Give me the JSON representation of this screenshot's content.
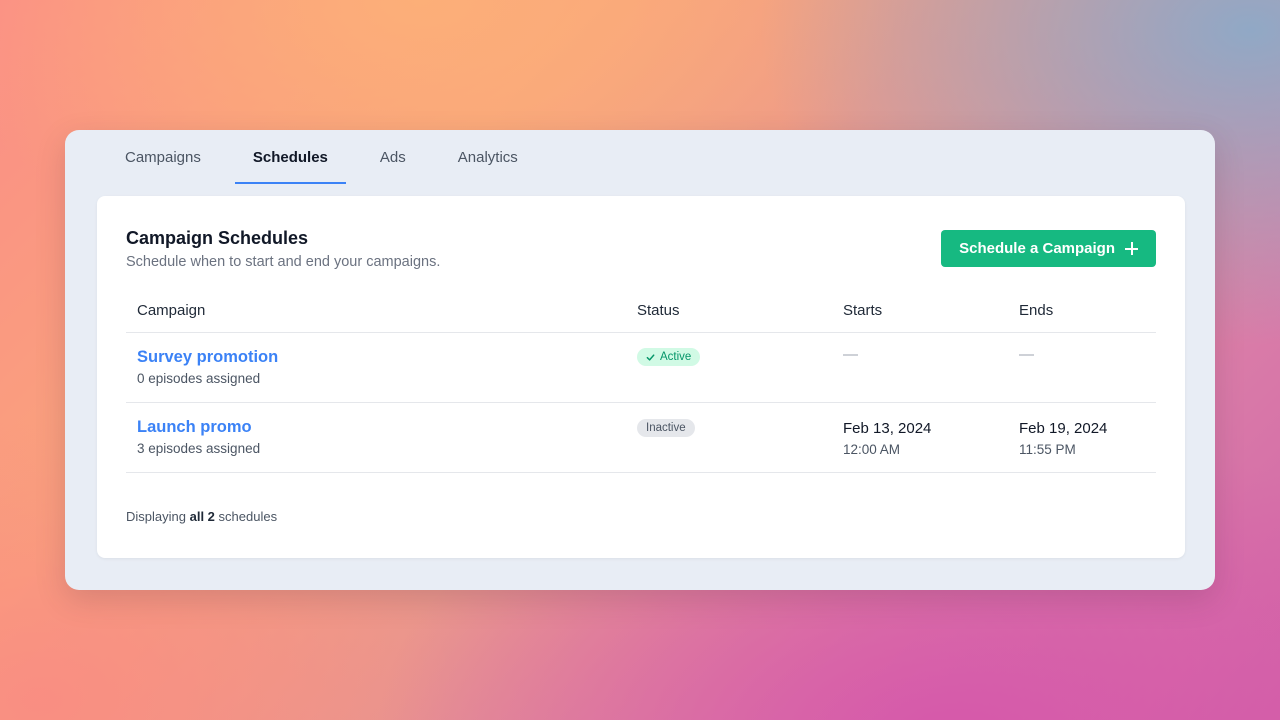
{
  "tabs": [
    {
      "label": "Campaigns",
      "active": false
    },
    {
      "label": "Schedules",
      "active": true
    },
    {
      "label": "Ads",
      "active": false
    },
    {
      "label": "Analytics",
      "active": false
    }
  ],
  "card": {
    "title": "Campaign Schedules",
    "subtitle": "Schedule when to start and end your campaigns.",
    "action_label": "Schedule a Campaign"
  },
  "table": {
    "columns": [
      "Campaign",
      "Status",
      "Starts",
      "Ends"
    ],
    "rows": [
      {
        "name": "Survey promotion",
        "episodes": "0 episodes assigned",
        "status": "Active",
        "starts_date": "—",
        "starts_time": "",
        "ends_date": "—",
        "ends_time": ""
      },
      {
        "name": "Launch promo",
        "episodes": "3 episodes assigned",
        "status": "Inactive",
        "starts_date": "Feb 13, 2024",
        "starts_time": "12:00 AM",
        "ends_date": "Feb 19, 2024",
        "ends_time": "11:55 PM"
      }
    ]
  },
  "footer": {
    "prefix": "Displaying",
    "count": "all 2",
    "suffix": "schedules"
  },
  "colors": {
    "accent": "#3b82f6",
    "primary_button": "#16b981",
    "active_badge_bg": "#d1fae5",
    "active_badge_text": "#059669",
    "inactive_badge_bg": "#e5e7eb"
  },
  "icons": {
    "button_icon": "plus-icon",
    "active_badge_icon": "check-icon"
  }
}
